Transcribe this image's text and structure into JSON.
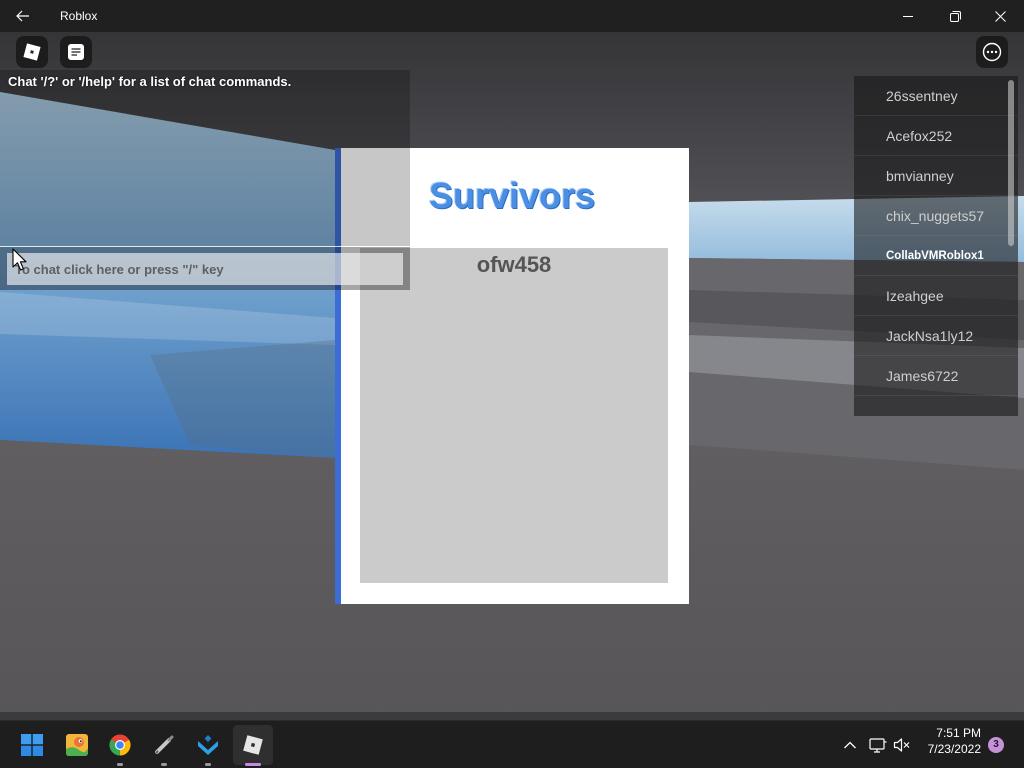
{
  "window": {
    "title": "Roblox",
    "back_icon": "back-arrow-icon",
    "minimize_icon": "minimize-icon",
    "maximize_icon": "restore-icon",
    "close_icon": "close-icon"
  },
  "hud": {
    "roblox_menu_icon": "roblox-logo-icon",
    "chat_toggle_icon": "chat-icon",
    "more_menu_icon": "more-options-icon"
  },
  "chat": {
    "system_message": "Chat '/?' or '/help' for a list of chat commands.",
    "input_placeholder": "To chat click here or press \"/\" key"
  },
  "survivors": {
    "title": "Survivors",
    "names": [
      "ofw458"
    ],
    "title_color": "#4b8fe4",
    "accent_color": "#3b6ed4"
  },
  "player_list": {
    "players": [
      {
        "name": "26ssentney"
      },
      {
        "name": "Acefox252"
      },
      {
        "name": "bmvianney"
      },
      {
        "name": "chix_nuggets57"
      },
      {
        "name": "CollabVMRoblox1",
        "is_local_player": true
      },
      {
        "name": "Izeahgee"
      },
      {
        "name": "JackNsa1ly12"
      },
      {
        "name": "James6722"
      }
    ]
  },
  "taskbar": {
    "apps": [
      {
        "icon": "windows-start-icon"
      },
      {
        "icon": "cartoon-app-icon"
      },
      {
        "icon": "chrome-icon",
        "running": true
      },
      {
        "icon": "pen-tool-icon",
        "running": true
      },
      {
        "icon": "blue-arrow-app-icon",
        "running": true
      },
      {
        "icon": "roblox-icon",
        "running": true,
        "active": true
      }
    ],
    "tray": {
      "overflow_icon": "chevron-up-icon",
      "network_icon": "network-icon",
      "volume_icon": "volume-muted-icon",
      "time": "7:51 PM",
      "date": "7/23/2022",
      "notification_count": "3"
    },
    "active_indicator_color": "#c78ae0"
  }
}
